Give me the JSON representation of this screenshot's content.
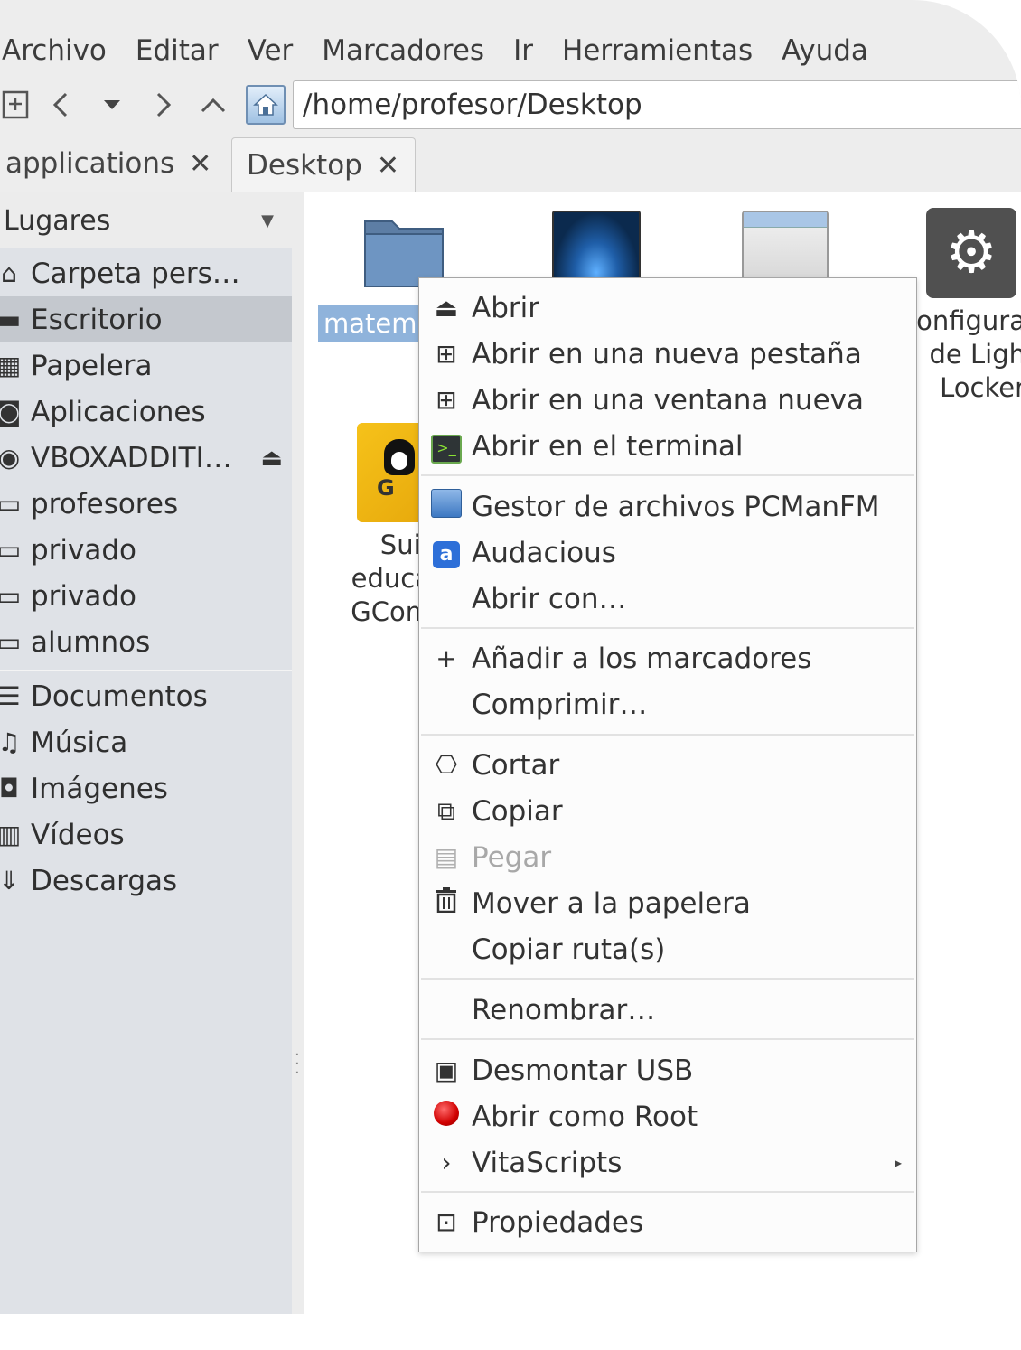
{
  "menubar": [
    "Archivo",
    "Editar",
    "Ver",
    "Marcadores",
    "Ir",
    "Herramientas",
    "Ayuda"
  ],
  "toolbar": {
    "new_tab_icon": "new-tab-icon",
    "back": "‹",
    "history": "▾",
    "forward": "›",
    "up": "^",
    "path": "/home/profesor/Desktop"
  },
  "tabs": [
    {
      "label": "applications",
      "close": "✕"
    },
    {
      "label": "Desktop",
      "close": "✕",
      "active": true
    }
  ],
  "sidebar": {
    "header": "Lugares",
    "items": [
      {
        "label": "Carpeta pers…",
        "icon": "home-icon",
        "glyph": "⌂"
      },
      {
        "label": "Escritorio",
        "icon": "desktop-icon",
        "glyph": "▬",
        "selected": true
      },
      {
        "label": "Papelera",
        "icon": "trash-icon",
        "glyph": "▦"
      },
      {
        "label": "Aplicaciones",
        "icon": "applications-icon",
        "glyph": "◙"
      },
      {
        "label": "VBOXADDITI…",
        "icon": "disc-icon",
        "glyph": "◉",
        "eject": "⏏"
      },
      {
        "label": "profesores",
        "icon": "network-share-icon",
        "glyph": "▭"
      },
      {
        "label": "privado",
        "icon": "network-share-icon",
        "glyph": "▭"
      },
      {
        "label": "privado",
        "icon": "network-share-icon",
        "glyph": "▭"
      },
      {
        "label": "alumnos",
        "icon": "network-share-icon",
        "glyph": "▭"
      },
      {
        "label": "Documentos",
        "icon": "documents-icon",
        "glyph": "☰"
      },
      {
        "label": "Música",
        "icon": "music-icon",
        "glyph": "♫"
      },
      {
        "label": "Imágenes",
        "icon": "pictures-icon",
        "glyph": "◘"
      },
      {
        "label": "Vídeos",
        "icon": "videos-icon",
        "glyph": "▥"
      },
      {
        "label": "Descargas",
        "icon": "downloads-icon",
        "glyph": "⇓"
      }
    ]
  },
  "files": {
    "selected_label": "matem",
    "gcompris_label": [
      "Suit",
      "educa",
      "GCom"
    ],
    "config_label": [
      "onfigura",
      "de Ligh",
      "Locker"
    ]
  },
  "context_menu": [
    {
      "label": "Abrir",
      "icon": "open-icon",
      "glyph": "⏏"
    },
    {
      "label": "Abrir en una nueva pestaña",
      "icon": "new-tab-icon",
      "glyph": "⊞"
    },
    {
      "label": "Abrir en una ventana nueva",
      "icon": "new-window-icon",
      "glyph": "⊞"
    },
    {
      "label": "Abrir en el terminal",
      "icon": "terminal-icon",
      "glyph": ">_"
    },
    {
      "label": "Gestor de archivos PCManFM",
      "icon": "pcmanfm-icon",
      "glyph": ""
    },
    {
      "label": "Audacious",
      "icon": "audacious-icon",
      "glyph": "a"
    },
    {
      "label": "Abrir con…",
      "icon": "",
      "glyph": ""
    },
    {
      "label": "Añadir a los marcadores",
      "icon": "add-icon",
      "glyph": "+"
    },
    {
      "label": "Comprimir…",
      "icon": "",
      "glyph": ""
    },
    {
      "label": "Cortar",
      "icon": "cut-icon",
      "glyph": "⎔"
    },
    {
      "label": "Copiar",
      "icon": "copy-icon",
      "glyph": "⧉"
    },
    {
      "label": "Pegar",
      "icon": "paste-icon",
      "glyph": "▤",
      "disabled": true
    },
    {
      "label": "Mover a la papelera",
      "icon": "trash-icon",
      "glyph": "🗑"
    },
    {
      "label": "Copiar ruta(s)",
      "icon": "",
      "glyph": ""
    },
    {
      "label": "Renombrar…",
      "icon": "",
      "glyph": ""
    },
    {
      "label": "Desmontar USB",
      "icon": "usb-icon",
      "glyph": "▣"
    },
    {
      "label": "Abrir como Root",
      "icon": "root-icon",
      "glyph": ""
    },
    {
      "label": "VitaScripts",
      "icon": "chevron-right-icon",
      "glyph": "›",
      "submenu_arrow": "▸"
    },
    {
      "label": "Propiedades",
      "icon": "properties-icon",
      "glyph": "⊡"
    }
  ]
}
